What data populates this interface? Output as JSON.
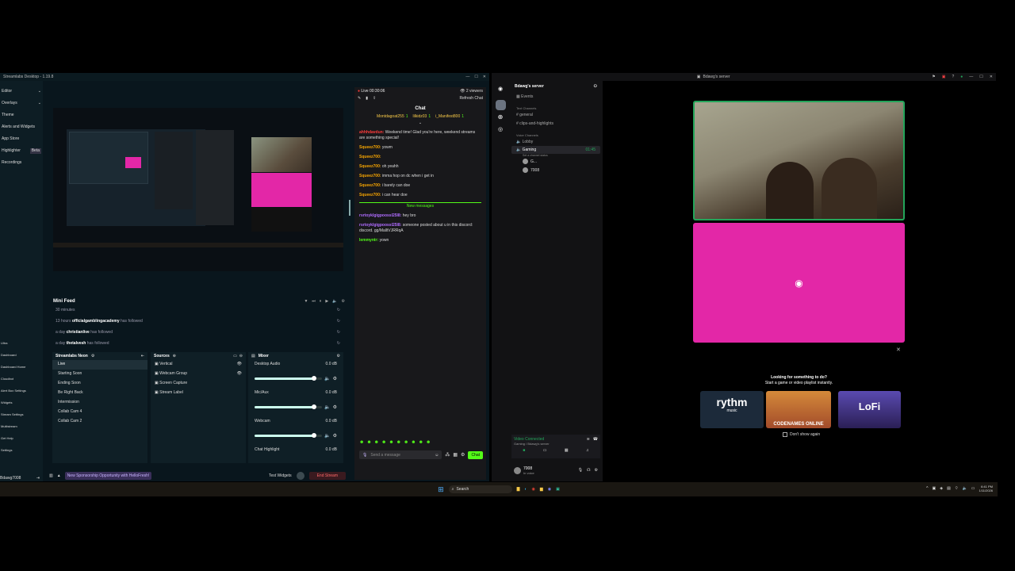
{
  "streamlabs": {
    "title": "Streamlabs Desktop - 1.19.8",
    "sidebar": [
      "Editor",
      "Overlays",
      "Theme",
      "Alerts and Widgets",
      "App Store",
      "Highlighter",
      "Recordings"
    ],
    "sidebar_badge": "Beta",
    "sidebar_bottom": [
      "Ultra",
      "Dashboard",
      "Dashboard Home",
      "Cloudbot",
      "Alert Box Settings",
      "Widgets",
      "Stream Settings",
      "Multistream",
      "Get Help",
      "Settings"
    ],
    "user": "Bdawg7008",
    "minifeed": {
      "title": "Mini Feed",
      "items": [
        {
          "time": "30 minutes",
          "name": "",
          "action": ""
        },
        {
          "time": "13 hours",
          "name": "officialgamblingacademy",
          "action": "has followed"
        },
        {
          "time": "a day",
          "name": "christianlive",
          "action": "has followed"
        },
        {
          "time": "a day",
          "name": "thetalvesh",
          "action": "has followed"
        }
      ]
    },
    "scenes": {
      "title": "Streamlabs Neon",
      "items": [
        "Live",
        "Starting Soon",
        "Ending Soon",
        "Be Right Back",
        "Intermission",
        "Collab Cam 4",
        "Collab Cam 2"
      ]
    },
    "sources": {
      "title": "Sources",
      "items": [
        "Vertical",
        "Webcam Group",
        "Screen Capture",
        "Stream Label"
      ]
    },
    "mixer": {
      "title": "Mixer",
      "items": [
        {
          "name": "Desktop Audio",
          "db": "0.0 dB",
          "level": 0.88
        },
        {
          "name": "Mic/Aux",
          "db": "0.0 dB",
          "level": 0.88
        },
        {
          "name": "Webcam",
          "db": "0.0 dB",
          "level": 0.88
        },
        {
          "name": "Chat Highlight",
          "db": "0.0 dB",
          "level": 0
        }
      ]
    },
    "footer": {
      "promo": "New Sponsorship Opportunity with HelloFresh!",
      "test": "Test Widgets",
      "end": "End Stream"
    }
  },
  "chat": {
    "live": "Live 00:30:06",
    "viewers": "2 viewers",
    "refresh": "Refresh Chat",
    "title": "Chat",
    "top": [
      {
        "name": "Montdagoat255",
        "count": "1"
      },
      {
        "name": "lilkidz03",
        "count": "1"
      },
      {
        "name": "i_Manifest800",
        "count": "1"
      }
    ],
    "messages": [
      {
        "user": "ahhhdavdun",
        "text": "Weekend time! Glad you're here, weekend streams are something special!",
        "color": "#ff3b3b"
      },
      {
        "user": "Squeez700",
        "text": "yowm",
        "color": "#f7a500"
      },
      {
        "user": "Squeez700",
        "text": "",
        "color": "#f7a500"
      },
      {
        "user": "Squeez700",
        "text": "oh yeahh",
        "color": "#f7a500"
      },
      {
        "user": "Squeez700",
        "text": "imma hop on dc when i get in",
        "color": "#f7a500"
      },
      {
        "user": "Squeez700",
        "text": "i barely can doe",
        "color": "#f7a500"
      },
      {
        "user": "Squeez700",
        "text": "i can hear doe",
        "color": "#f7a500"
      }
    ],
    "divider": "New messages",
    "new_messages": [
      {
        "user": "rsrtoyklgigpoossl25l8",
        "text": "hey bro",
        "color": "#b06cff"
      },
      {
        "user": "rsrtoyklgigpoossl25l8",
        "text": "someone posted about u in this discord: discord. gg/MalltVJRRqA",
        "color": "#b06cff"
      },
      {
        "user": "lemmyntr",
        "text": "yown",
        "color": "#53fc18"
      }
    ],
    "input_placeholder": "Send a message",
    "chat_btn": "Chat"
  },
  "discord": {
    "window_title": "Bdawg's server",
    "server": "Bdawg's server",
    "events": "Events",
    "text_header": "Text Channels",
    "text_channels": [
      "general",
      "clips-and-highlights"
    ],
    "voice_header": "Voice Channels",
    "voice_channels": [
      "Lobby",
      "Gaming"
    ],
    "gaming_time": "01:45",
    "gaming_status": "Set a channel status",
    "voice_users": [
      "G...",
      "7008"
    ],
    "vc_status": "Video Connected",
    "vc_sub": "Gaming / Bdawg's server",
    "user": "7008",
    "user_status": "In voice",
    "activity_title": "Looking for something to do?",
    "activity_sub": "Start a game or video playlist instantly.",
    "tiles": [
      "rythm",
      "CODENAMES ONLINE",
      "LoFi"
    ],
    "tile_sub": "music",
    "dont_show": "Don't show again",
    "pink": "#e327a7"
  },
  "taskbar": {
    "search": "Search",
    "time": "6:41 PM",
    "date": "1/11/2026"
  }
}
